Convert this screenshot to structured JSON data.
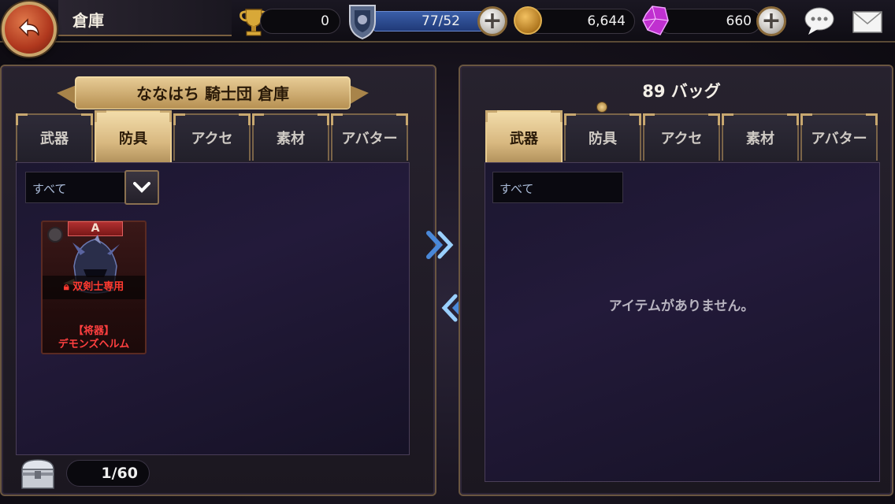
{
  "header": {
    "title": "倉庫",
    "trophy_count": "0",
    "stamina": "77/52",
    "gold": "6,644",
    "gems": "660"
  },
  "left_panel": {
    "banner": "ななはち 騎士団 倉庫",
    "tabs": [
      {
        "label": "武器",
        "active": false
      },
      {
        "label": "防具",
        "active": true
      },
      {
        "label": "アクセ",
        "active": false
      },
      {
        "label": "素材",
        "active": false
      },
      {
        "label": "アバター",
        "active": false
      }
    ],
    "filter": "すべて",
    "items": [
      {
        "grade": "A",
        "restriction": "双剣士専用",
        "name_line1": "【将器】",
        "name_line2": "デモンズヘルム"
      }
    ],
    "capacity": "1/60"
  },
  "right_panel": {
    "bag_count": "89 バッグ",
    "tabs": [
      {
        "label": "武器",
        "active": true
      },
      {
        "label": "防具",
        "active": false
      },
      {
        "label": "アクセ",
        "active": false
      },
      {
        "label": "素材",
        "active": false
      },
      {
        "label": "アバター",
        "active": false
      }
    ],
    "filter": "すべて",
    "empty_message": "アイテムがありません。"
  },
  "icons": {
    "back": "back-arrow-icon",
    "trophy": "trophy-icon",
    "shield": "shield-icon",
    "coin": "gold-coin-icon",
    "gem": "gem-icon",
    "chat": "chat-icon",
    "mail": "mail-icon",
    "chest": "chest-icon"
  }
}
